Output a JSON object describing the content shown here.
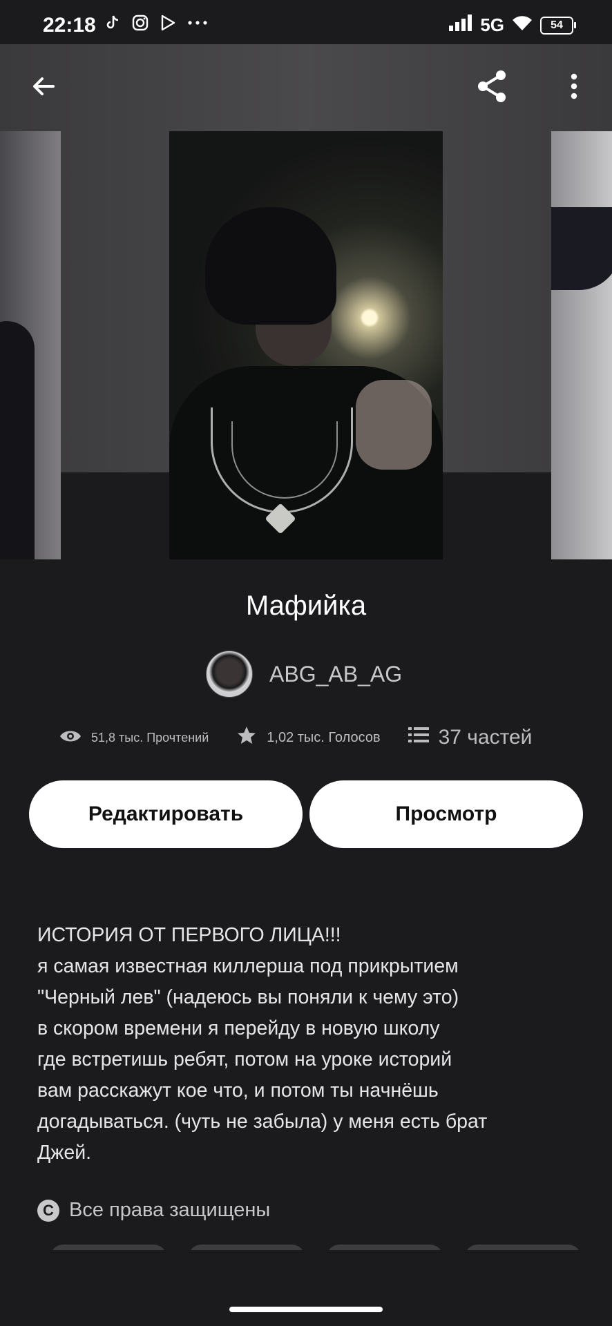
{
  "status_bar": {
    "time": "22:18",
    "network": "5G",
    "battery": "54",
    "left_icons": [
      "tiktok-icon",
      "instagram-icon",
      "play-icon",
      "more-dots-icon"
    ],
    "right_icons": [
      "signal-icon",
      "wifi-icon",
      "battery-icon"
    ]
  },
  "toolbar": {
    "icons": [
      "back-arrow-icon",
      "share-icon",
      "more-vertical-icon"
    ]
  },
  "story": {
    "title": "Мафийка",
    "author": "ABG_AB_AG",
    "stats": {
      "reads": "51,8 тыс. Прочтений",
      "votes": "1,02 тыс. Голосов",
      "parts": "37 частей"
    },
    "buttons": {
      "edit": "Редактировать",
      "view": "Просмотр"
    },
    "description_lines": [
      "ИСТОРИЯ ОТ ПЕРВОГО ЛИЦА!!!",
      "я самая известная киллерша под прикрытием",
      "\"Черный лев\" (надеюсь вы поняли к чему это)",
      "в скором времени я перейду в новую школу",
      "где встретишь ребят, потом на уроке историй",
      "вам расскажут кое что, и потом ты начнёшь",
      "догадываться. (чуть не забыла) у меня есть брат",
      "Джей."
    ],
    "rights": "Все права защищены"
  },
  "colors": {
    "background": "#1b1a1c",
    "button_bg": "#ffffff",
    "muted_text": "#c8c8ca"
  }
}
